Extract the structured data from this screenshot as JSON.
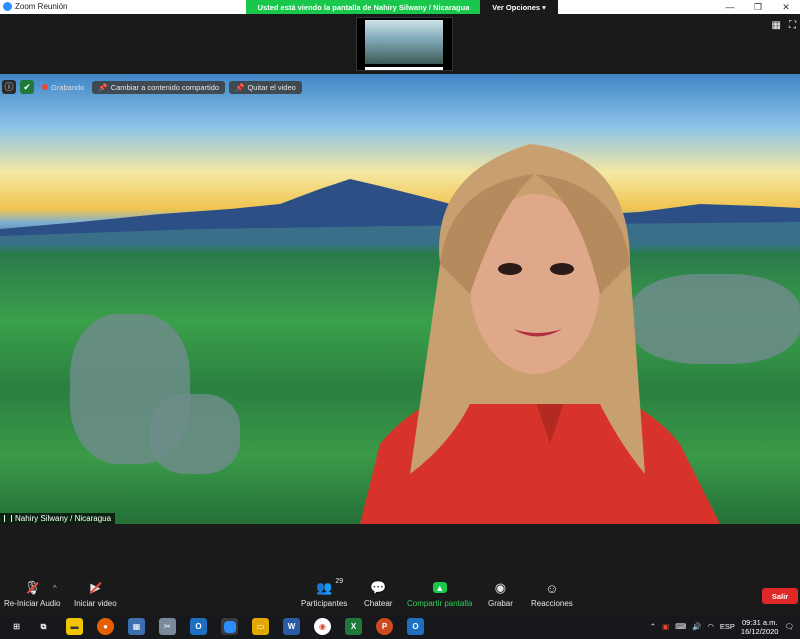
{
  "window": {
    "title": "Zoom Reunión",
    "controls": [
      "—",
      "❐",
      "✕"
    ]
  },
  "share_banner": {
    "message": "Usted está viendo la pantalla de Nahiry Silwany / Nicaragua",
    "options_label": "Ver Opciones"
  },
  "overlay": {
    "recording_label": "Grabando",
    "switch_content_label": "Cambiar a contenido compartido",
    "remove_video_label": "Quitar el video"
  },
  "participant": {
    "name": "Nahiry Silwany / Nicaragua"
  },
  "toolbar": {
    "audio_label": "Re-Iniciar Audio",
    "video_label": "Iniciar video",
    "participants_label": "Participantes",
    "participants_count": "29",
    "chat_label": "Chatear",
    "share_label": "Compartir pantalla",
    "record_label": "Grabar",
    "reactions_label": "Reacciones",
    "leave_label": "Salir"
  },
  "taskbar": {
    "language": "ESP",
    "time": "09:31 a.m.",
    "date": "16/12/2020"
  },
  "colors": {
    "share_green": "#18c74c",
    "leave_red": "#e02828",
    "toolbar_bg": "#1a1a1a"
  }
}
